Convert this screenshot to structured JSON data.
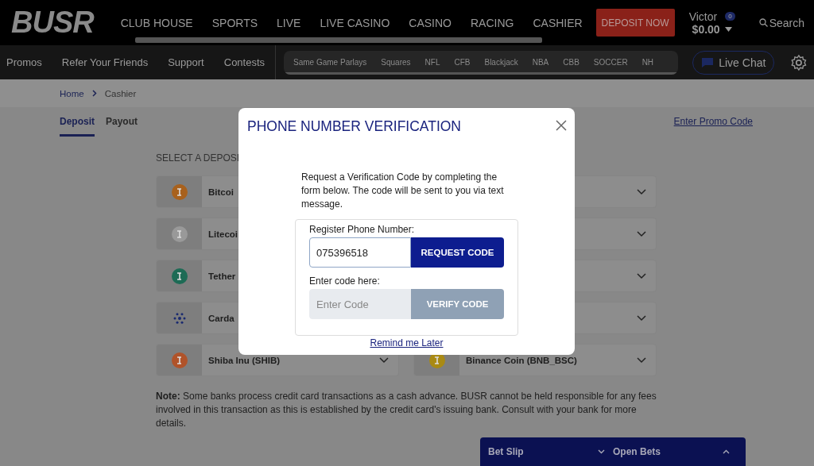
{
  "header": {
    "logo": "BUSR",
    "nav": [
      "CLUB HOUSE",
      "SPORTS",
      "LIVE",
      "LIVE CASINO",
      "CASINO",
      "RACING",
      "CASHIER"
    ],
    "deposit_button": "DEPOSIT NOW",
    "account": {
      "name": "Victor",
      "badge": "0",
      "balance": "$0.00"
    },
    "search": "Search"
  },
  "subnav": {
    "links": [
      "Promos",
      "Refer Your Friends",
      "Support",
      "Contests"
    ],
    "chips": [
      "Same Game Parlays",
      "Squares",
      "NFL",
      "CFB",
      "Blackjack",
      "NBA",
      "CBB",
      "SOCCER",
      "NH"
    ],
    "live_chat": "Live Chat"
  },
  "breadcrumb": [
    "Home",
    "Cashier"
  ],
  "tabs": [
    {
      "label": "Deposit",
      "selected": true
    },
    {
      "label": "Payout",
      "selected": false
    }
  ],
  "promo_link": "Enter Promo Code",
  "section_title": "SELECT A DEPOSI",
  "methods": [
    {
      "kind": "bitcoin",
      "label": "Bitcoi"
    },
    {
      "kind": "blank"
    },
    {
      "kind": "litecoin",
      "label": "Litecoi"
    },
    {
      "kind": "blank"
    },
    {
      "kind": "tether",
      "label": "Tether"
    },
    {
      "kind": "blank"
    },
    {
      "kind": "cardano",
      "label": "Carda"
    },
    {
      "kind": "blank"
    },
    {
      "kind": "shiba",
      "label": "Shiba Inu (SHIB)"
    },
    {
      "kind": "binance",
      "label": "Binance Coin (BNB_BSC)"
    }
  ],
  "note": "**Note:** Some banks process credit card transactions as a cash advance. BUSR cannot be held responsible for any fees involved in this transaction as this is established by the credit card's issuing bank. Consult with your bank for more details.",
  "modal": {
    "title": "PHONE NUMBER VERIFICATION",
    "intro": "Request a Verification Code by completing the form below. The code will be sent to you via text message.",
    "phone_label": "Register Phone Number:",
    "phone_value": "075396518",
    "request_button": "REQUEST CODE",
    "code_label": "Enter code here:",
    "code_placeholder": "Enter Code",
    "verify_button": {
      "label": "VERIFY CODE",
      "disabled": true
    },
    "remind_link": "Remind me Later"
  },
  "bet_slip": {
    "tabs": [
      "Bet Slip",
      "Open Bets"
    ]
  }
}
